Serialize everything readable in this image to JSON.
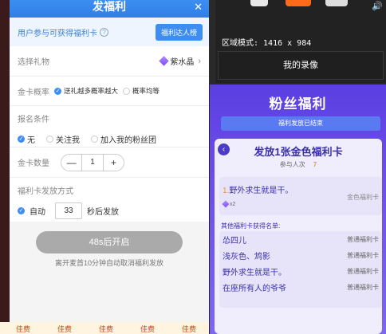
{
  "modal": {
    "title": "发福利",
    "close_icon": "close-icon",
    "info_text": "用户参与可获得福利卡",
    "help_icon": "question-icon",
    "expert_button": "福利达人榜",
    "gift_label": "选择礼物",
    "gift_value": "紫水晶",
    "prob_label": "金卡概率",
    "prob_options": [
      "送礼越多概率越大",
      "概率均等"
    ],
    "cond_label": "报名条件",
    "cond_options": [
      "无",
      "关注我",
      "加入我的粉丝团"
    ],
    "qty_label": "金卡数量",
    "qty_minus": "—",
    "qty_value": "1",
    "qty_plus": "+",
    "way_label": "福利卡发放方式",
    "way_auto": "自动",
    "way_seconds": "33",
    "way_suffix": "秒后发放",
    "start_button": "48s后开启",
    "hint": "离开麦首10分钟自动取消福利发放"
  },
  "recorder": {
    "mode_text": "区域模式: 1416 x 984",
    "my_recordings": "我的录像",
    "volume_icon": "volume-icon"
  },
  "fan": {
    "banner": "粉丝福利",
    "status": "福利发放已结束",
    "title": "发放1张金色福利卡",
    "join_label": "参与人次",
    "join_count": "7",
    "winner_rank": "1.",
    "winner_name": "野外求生就是干。",
    "winner_tier": "金色福利卡",
    "winner_multiplier": "x2",
    "others_title": "其他福利卡获得名单:",
    "others": [
      {
        "name": "怂四儿",
        "tier": "普通福利卡"
      },
      {
        "name": "浅灰色、鸩影",
        "tier": "普通福利卡"
      },
      {
        "name": "野外求生就是干。",
        "tier": "普通福利卡"
      },
      {
        "name": "在座所有人的爷爷",
        "tier": "普通福利卡"
      }
    ]
  },
  "bottom_strip": [
    "佳费",
    "佳费",
    "佳费",
    "佳费",
    "佳费"
  ],
  "colors": {
    "accent": "#3d8ef0",
    "purple": "#6a4bea",
    "gold": "#f39c12"
  }
}
